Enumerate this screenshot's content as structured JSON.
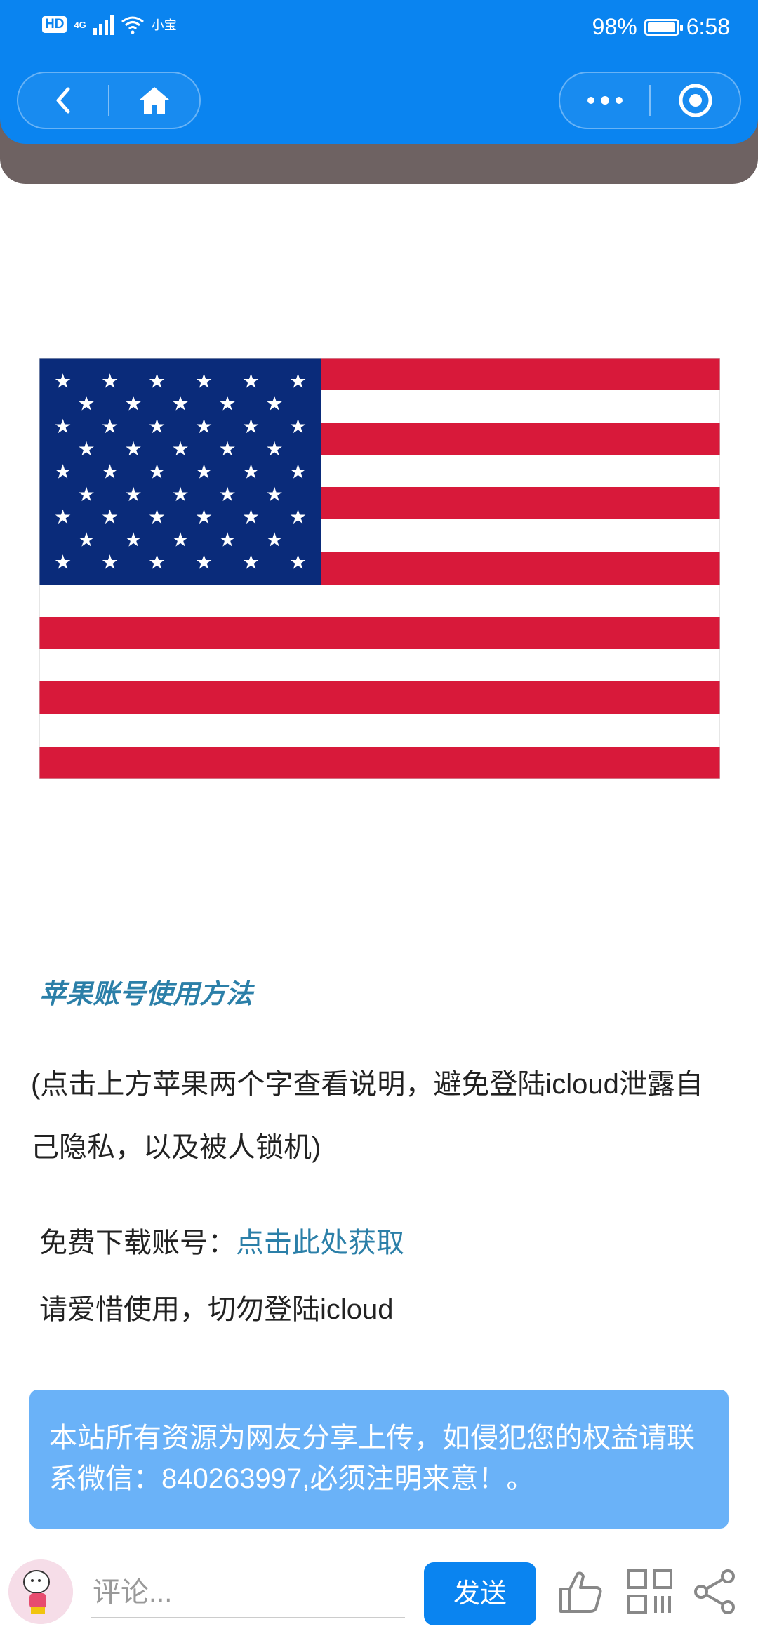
{
  "status_bar": {
    "hd": "HD",
    "signal": "4G",
    "carrier": "小宝",
    "battery": "98%",
    "time": "6:58"
  },
  "nav": {
    "back_icon": "chevron-left-icon",
    "home_icon": "home-icon",
    "more_icon": "more-dots-icon",
    "close_icon": "target-icon",
    "accent": "#0a84f0"
  },
  "content": {
    "heading": "苹果账号使用方法",
    "description": "(点击上方苹果两个字查看说明，避免登陆icloud泄露自己隐私，以及被人锁机)",
    "download_label": "免费下载账号：",
    "download_link": "点击此处获取",
    "reminder": "请爱惜使用，切勿登陆icloud",
    "notice": "本站所有资源为网友分享上传，如侵犯您的权益请联系微信：840263997,必须注明来意！。"
  },
  "bottom_bar": {
    "comment_placeholder": "评论...",
    "send_label": "发送",
    "like_icon": "thumbs-up-icon",
    "qr_icon": "qr-code-icon",
    "share_icon": "share-icon"
  }
}
